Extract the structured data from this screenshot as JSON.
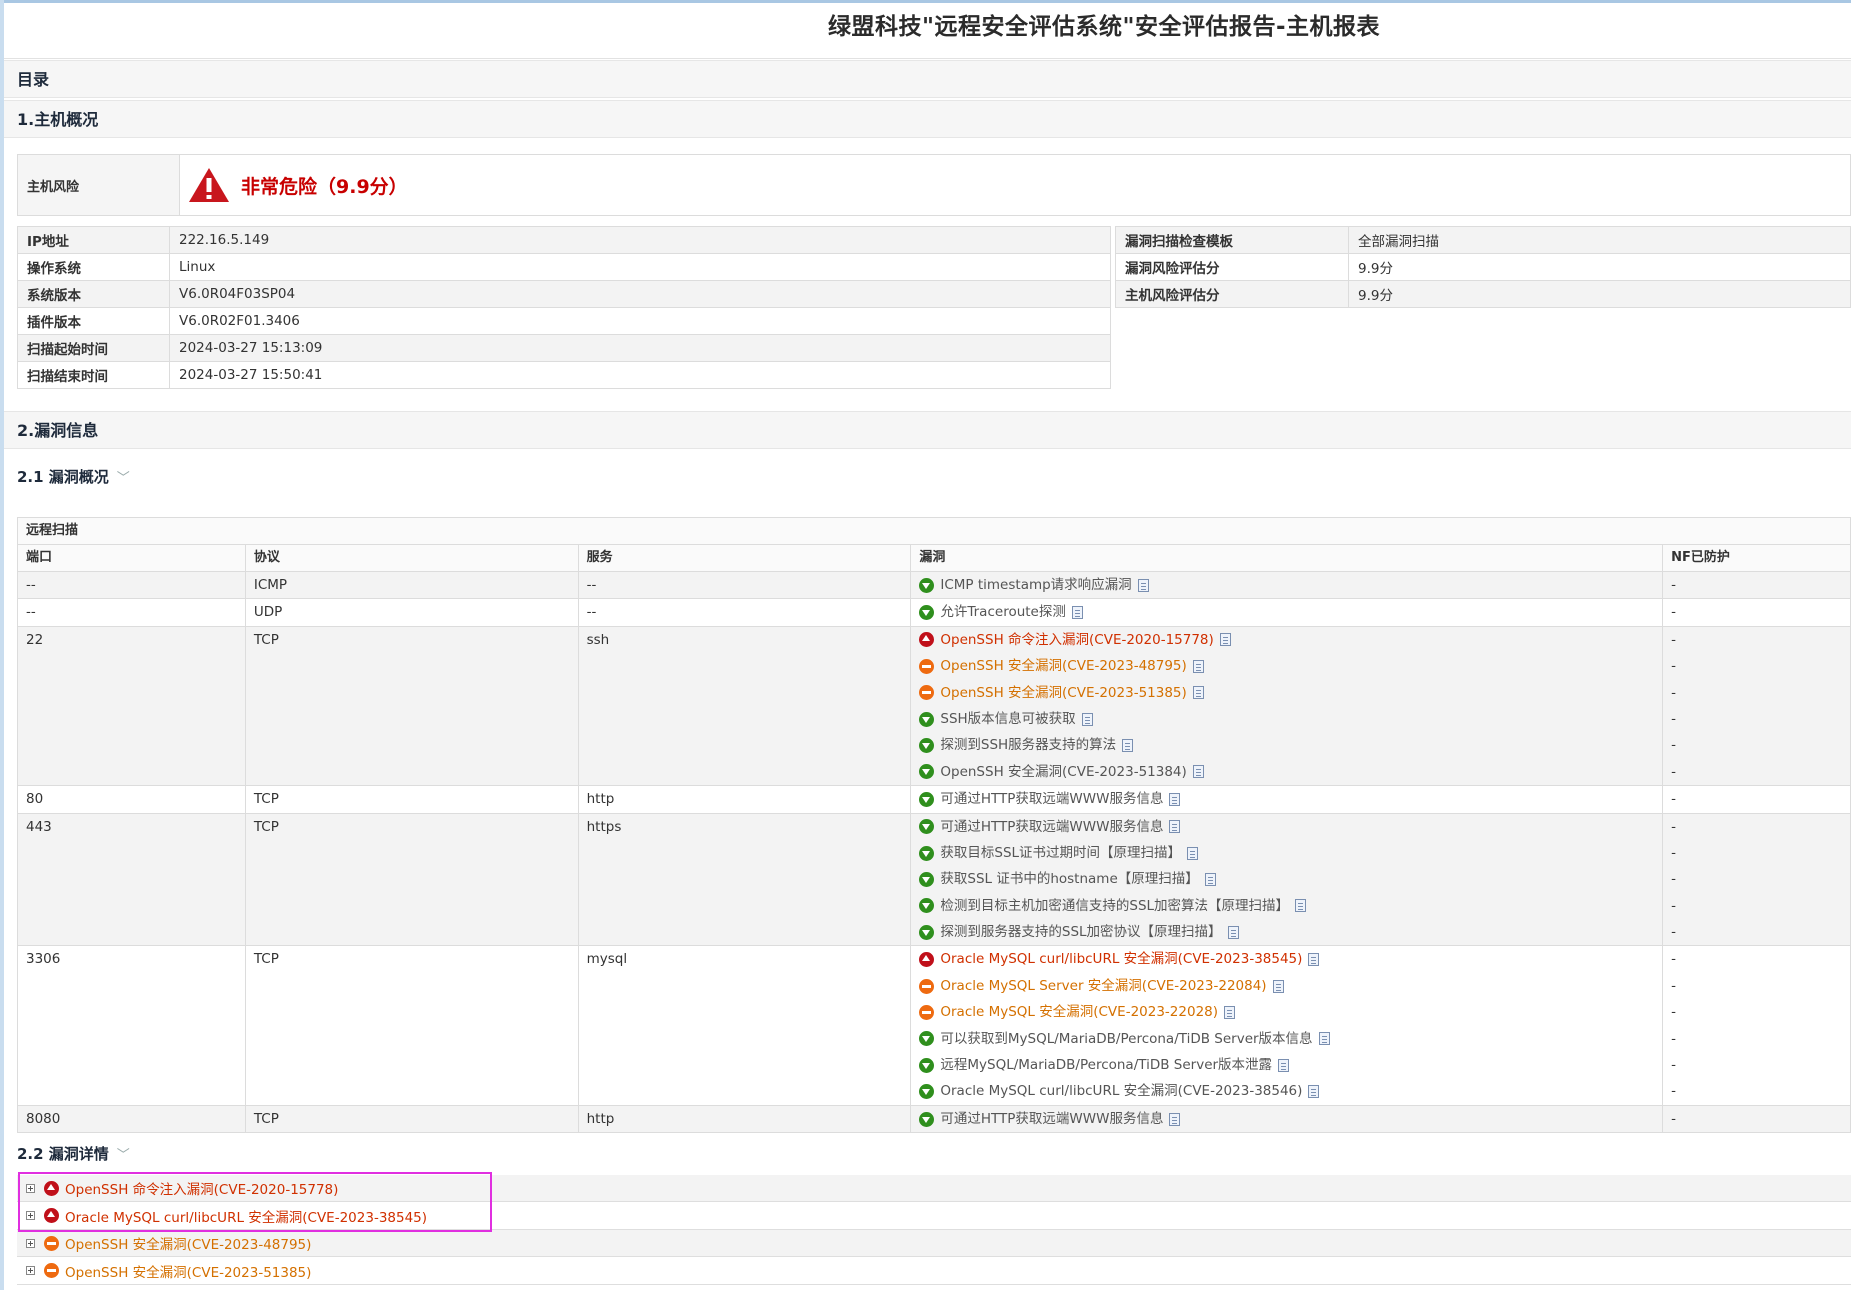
{
  "report": {
    "title": "绿盟科技\"远程安全评估系统\"安全评估报告-主机报表"
  },
  "toc": {
    "label": "目录"
  },
  "sections": {
    "host_overview": "1.主机概况",
    "vuln_info": "2.漏洞信息",
    "vuln_overview": "2.1 漏洞概况",
    "vuln_detail": "2.2 漏洞详情"
  },
  "host_risk": {
    "label": "主机风险",
    "value": "非常危险（9.9分）",
    "color": "#c80000"
  },
  "host_info": [
    {
      "key": "IP地址",
      "value": "222.16.5.149"
    },
    {
      "key": "操作系统",
      "value": "Linux"
    },
    {
      "key": "系统版本",
      "value": "V6.0R04F03SP04"
    },
    {
      "key": "插件版本",
      "value": "V6.0R02F01.3406"
    },
    {
      "key": "扫描起始时间",
      "value": "2024-03-27 15:13:09"
    },
    {
      "key": "扫描结束时间",
      "value": "2024-03-27 15:50:41"
    }
  ],
  "scan_info": [
    {
      "key": "漏洞扫描检查模板",
      "value": "全部漏洞扫描"
    },
    {
      "key": "漏洞风险评估分",
      "value": "9.9分"
    },
    {
      "key": "主机风险评估分",
      "value": "9.9分"
    }
  ],
  "overview_table": {
    "caption": "远程扫描",
    "headers": [
      "端口",
      "协议",
      "服务",
      "漏洞",
      "NF已防护"
    ],
    "rows": [
      {
        "port": "--",
        "protocol": "ICMP",
        "service": "--",
        "vulns": [
          {
            "name": "ICMP timestamp请求响应漏洞",
            "severity": "low",
            "nf": "-"
          }
        ]
      },
      {
        "port": "--",
        "protocol": "UDP",
        "service": "--",
        "vulns": [
          {
            "name": "允许Traceroute探测",
            "severity": "low",
            "nf": "-"
          }
        ]
      },
      {
        "port": "22",
        "protocol": "TCP",
        "service": "ssh",
        "vulns": [
          {
            "name": "OpenSSH 命令注入漏洞(CVE-2020-15778)",
            "severity": "high",
            "nf": "-"
          },
          {
            "name": "OpenSSH 安全漏洞(CVE-2023-48795)",
            "severity": "mid",
            "nf": "-"
          },
          {
            "name": "OpenSSH 安全漏洞(CVE-2023-51385)",
            "severity": "mid",
            "nf": "-"
          },
          {
            "name": "SSH版本信息可被获取",
            "severity": "low",
            "nf": "-"
          },
          {
            "name": "探测到SSH服务器支持的算法",
            "severity": "low",
            "nf": "-"
          },
          {
            "name": "OpenSSH 安全漏洞(CVE-2023-51384)",
            "severity": "low",
            "nf": "-"
          }
        ]
      },
      {
        "port": "80",
        "protocol": "TCP",
        "service": "http",
        "vulns": [
          {
            "name": "可通过HTTP获取远端WWW服务信息",
            "severity": "low",
            "nf": "-"
          }
        ]
      },
      {
        "port": "443",
        "protocol": "TCP",
        "service": "https",
        "vulns": [
          {
            "name": "可通过HTTP获取远端WWW服务信息",
            "severity": "low",
            "nf": "-"
          },
          {
            "name": "获取目标SSL证书过期时间【原理扫描】",
            "severity": "low",
            "nf": "-"
          },
          {
            "name": "获取SSL 证书中的hostname【原理扫描】",
            "severity": "low",
            "nf": "-"
          },
          {
            "name": "检测到目标主机加密通信支持的SSL加密算法【原理扫描】",
            "severity": "low",
            "nf": "-"
          },
          {
            "name": "探测到服务器支持的SSL加密协议【原理扫描】",
            "severity": "low",
            "nf": "-"
          }
        ]
      },
      {
        "port": "3306",
        "protocol": "TCP",
        "service": "mysql",
        "vulns": [
          {
            "name": "Oracle MySQL curl/libcURL 安全漏洞(CVE-2023-38545)",
            "severity": "high",
            "nf": "-"
          },
          {
            "name": "Oracle MySQL Server 安全漏洞(CVE-2023-22084)",
            "severity": "mid",
            "nf": "-"
          },
          {
            "name": "Oracle MySQL 安全漏洞(CVE-2023-22028)",
            "severity": "mid",
            "nf": "-"
          },
          {
            "name": "可以获取到MySQL/MariaDB/Percona/TiDB Server版本信息",
            "severity": "low",
            "nf": "-"
          },
          {
            "name": "远程MySQL/MariaDB/Percona/TiDB Server版本泄露",
            "severity": "low",
            "nf": "-"
          },
          {
            "name": "Oracle MySQL curl/libcURL 安全漏洞(CVE-2023-38546)",
            "severity": "low",
            "nf": "-"
          }
        ]
      },
      {
        "port": "8080",
        "protocol": "TCP",
        "service": "http",
        "vulns": [
          {
            "name": "可通过HTTP获取远端WWW服务信息",
            "severity": "low",
            "nf": "-"
          }
        ]
      }
    ]
  },
  "details": [
    {
      "name": "OpenSSH 命令注入漏洞(CVE-2020-15778)",
      "severity": "high"
    },
    {
      "name": "Oracle MySQL curl/libcURL 安全漏洞(CVE-2023-38545)",
      "severity": "high"
    },
    {
      "name": "OpenSSH 安全漏洞(CVE-2023-48795)",
      "severity": "mid"
    },
    {
      "name": "OpenSSH 安全漏洞(CVE-2023-51385)",
      "severity": "mid"
    }
  ],
  "colors": {
    "high": "#d03000",
    "mid": "#d47000",
    "low": "#555555",
    "highlight": "#e02fe0"
  }
}
